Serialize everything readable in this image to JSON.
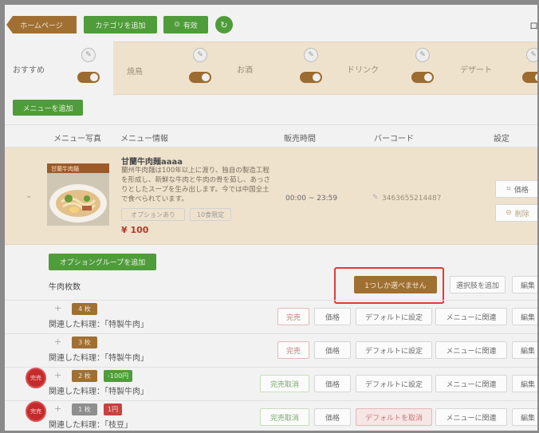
{
  "topbar": {
    "home": "ホームページ",
    "add_category": "カテゴリを追加",
    "enabled": "有效",
    "enabled_icon": "check-circle-icon",
    "right_text": "ロ"
  },
  "categories": [
    {
      "label": "おすすめ"
    },
    {
      "label": "焼鳥"
    },
    {
      "label": "お酒"
    },
    {
      "label": "ドリンク"
    },
    {
      "label": "デザート"
    }
  ],
  "add_menu": "メニューを追加",
  "table": {
    "headers": [
      "メニュー写真",
      "メニュー情報",
      "販売時間",
      "バーコード",
      "設定"
    ]
  },
  "menu_item": {
    "name": "甘蘭牛肉麺aaaa",
    "desc": "蘭州牛肉麺は100年以上に渡り、独自の製造工程を形成し、新鮮な牛肉と牛肉の骨を茹し、あっさりとしたスープを生み出します。今では中国全土で食べられています。",
    "tag_option": "オプションあり",
    "tag_limit": "10食限定",
    "price": "¥ 100",
    "sale_time": "00:00 ~ 23:59",
    "barcode": "3463655214487",
    "btn_price": "価格",
    "btn_delete": "削除",
    "image_caption": "甘蘭牛肉麺"
  },
  "options": {
    "add_group": "オプショングループを追加",
    "group_name": "牛肉枚数",
    "only_one": "1つしか選べません",
    "add_choice": "選択肢を追加",
    "edit": "編集",
    "rows": [
      {
        "num": "4 枚",
        "related": "関連した料理：「特製牛肉」",
        "status": "完売",
        "price": "価格",
        "default": "デフォルトに設定",
        "link": "メニューに関連",
        "edit": "編集",
        "badge": "",
        "soldout": ""
      },
      {
        "num": "3 枚",
        "related": "関連した料理：「特製牛肉」",
        "status": "完売",
        "price": "価格",
        "default": "デフォルトに設定",
        "link": "メニューに関連",
        "edit": "編集",
        "badge": "",
        "soldout": ""
      },
      {
        "num": "2 枚",
        "related": "関連した料理：「特製牛肉」",
        "status": "完売取消",
        "price": "価格",
        "default": "デフォルトに設定",
        "link": "メニューに関連",
        "edit": "編集",
        "badge": "-100円",
        "soldout": "完売"
      },
      {
        "num": "1 枚",
        "related": "関連した料理：「枝豆」",
        "status": "完売取消",
        "price": "価格",
        "default": "デフォルトを取消",
        "link": "メニューに関連",
        "edit": "編集",
        "badge": "1円",
        "soldout": "完売"
      }
    ]
  },
  "colors": {
    "highlight": "#e03a3a",
    "brown": "#a07033",
    "green": "#4f9c3a"
  }
}
